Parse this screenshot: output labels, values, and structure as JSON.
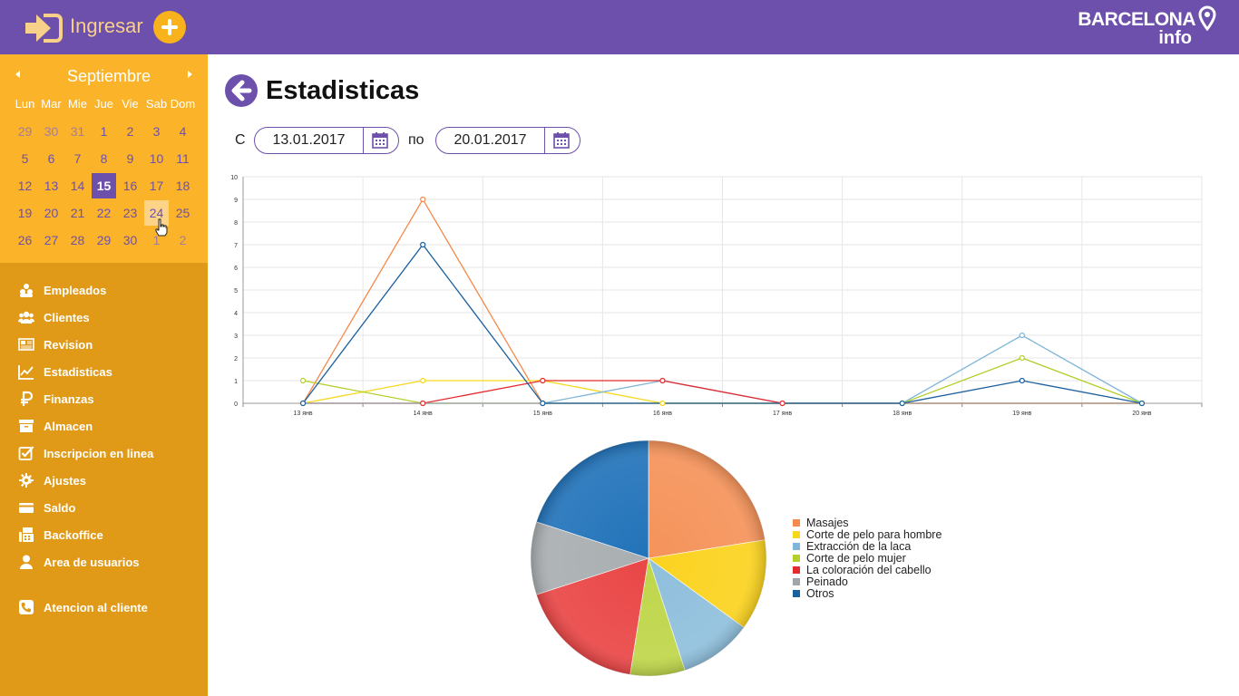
{
  "header": {
    "login_label": "Ingresar",
    "logo_name": "BARCELONA",
    "logo_sub": "info"
  },
  "calendar": {
    "month": "Septiembre",
    "weekdays": [
      "Lun",
      "Mar",
      "Mie",
      "Jue",
      "Vie",
      "Sab",
      "Dom"
    ],
    "weeks": [
      [
        "29",
        "30",
        "31",
        "1",
        "2",
        "3",
        "4"
      ],
      [
        "5",
        "6",
        "7",
        "8",
        "9",
        "10",
        "11"
      ],
      [
        "12",
        "13",
        "14",
        "15",
        "16",
        "17",
        "18"
      ],
      [
        "19",
        "20",
        "21",
        "22",
        "23",
        "24",
        "25"
      ],
      [
        "26",
        "27",
        "28",
        "29",
        "30",
        "1",
        "2"
      ]
    ],
    "selected_day": "15",
    "hovered_day": "24"
  },
  "menu": [
    {
      "label": "Empleados",
      "icon": "users-icon"
    },
    {
      "label": "Clientes",
      "icon": "group-icon"
    },
    {
      "label": "Revision",
      "icon": "newspaper-icon"
    },
    {
      "label": "Estadisticas",
      "icon": "chart-line-icon"
    },
    {
      "label": "Finanzas",
      "icon": "ruble-icon"
    },
    {
      "label": "Almacen",
      "icon": "archive-icon"
    },
    {
      "label": "Inscripcion en linea",
      "icon": "checkbox-icon"
    },
    {
      "label": "Ajustes",
      "icon": "gear-icon"
    },
    {
      "label": "Saldo",
      "icon": "credit-card-icon"
    },
    {
      "label": "Backoffice",
      "icon": "fax-icon"
    },
    {
      "label": "Area de usuarios",
      "icon": "user-icon"
    },
    {
      "label": "Atencion al cliente",
      "icon": "phone-icon"
    }
  ],
  "page": {
    "title": "Estadisticas",
    "from_label": "С",
    "to_label": "по",
    "date_from": "13.01.2017",
    "date_to": "20.01.2017"
  },
  "colors": {
    "purple": "#6d50ab",
    "sidebar": "#e09a18",
    "calendar": "#fbb42a",
    "accent": "#f7b21c"
  },
  "chart_data": [
    {
      "type": "line",
      "categories": [
        "13 янв",
        "14 янв",
        "15 янв",
        "16 янв",
        "17 янв",
        "18 янв",
        "19 янв",
        "20 янв"
      ],
      "ylim": [
        0,
        10
      ],
      "yticks": [
        "0",
        "1",
        "2",
        "3",
        "4",
        "5",
        "6",
        "7",
        "8",
        "9",
        "10"
      ],
      "grid": true,
      "series": [
        {
          "name": "Masajes",
          "color": "#f58a4c",
          "values": [
            0,
            9,
            0,
            0,
            0,
            0,
            0,
            0
          ]
        },
        {
          "name": "Corte de pelo para hombre",
          "color": "#f7d71c",
          "values": [
            0,
            1,
            1,
            0,
            0,
            0,
            0,
            0
          ]
        },
        {
          "name": "Extracción de la laca",
          "color": "#7fb5d8",
          "values": [
            0,
            0,
            0,
            1,
            0,
            0,
            3,
            0
          ]
        },
        {
          "name": "Corte de pelo mujer",
          "color": "#b5cf2c",
          "values": [
            1,
            0,
            0,
            0,
            0,
            0,
            2,
            0
          ]
        },
        {
          "name": "La coloración del cabello",
          "color": "#e32b2f",
          "values": [
            0,
            0,
            1,
            1,
            0,
            0,
            0,
            0
          ]
        },
        {
          "name": "Peinado",
          "color": "#a0a5a8",
          "values": [
            0,
            0,
            0,
            0,
            0,
            0,
            0,
            0
          ]
        },
        {
          "name": "Otros",
          "color": "#1a5f9e",
          "values": [
            0,
            7,
            0,
            0,
            0,
            0,
            1,
            0
          ]
        }
      ]
    },
    {
      "type": "pie",
      "legend": "right",
      "slices": [
        {
          "name": "Masajes",
          "color": "#f5935a",
          "value": 9
        },
        {
          "name": "Corte de pelo para hombre",
          "color": "#fbd31f",
          "value": 5
        },
        {
          "name": "Extracción de la laca",
          "color": "#8fbfdc",
          "value": 4
        },
        {
          "name": "Corte de pelo mujer",
          "color": "#bfd64a",
          "value": 3
        },
        {
          "name": "La coloración del cabello",
          "color": "#ea4646",
          "value": 7
        },
        {
          "name": "Peinado",
          "color": "#a9aeb1",
          "value": 4
        },
        {
          "name": "Otros",
          "color": "#2273ba",
          "value": 8
        }
      ]
    }
  ]
}
